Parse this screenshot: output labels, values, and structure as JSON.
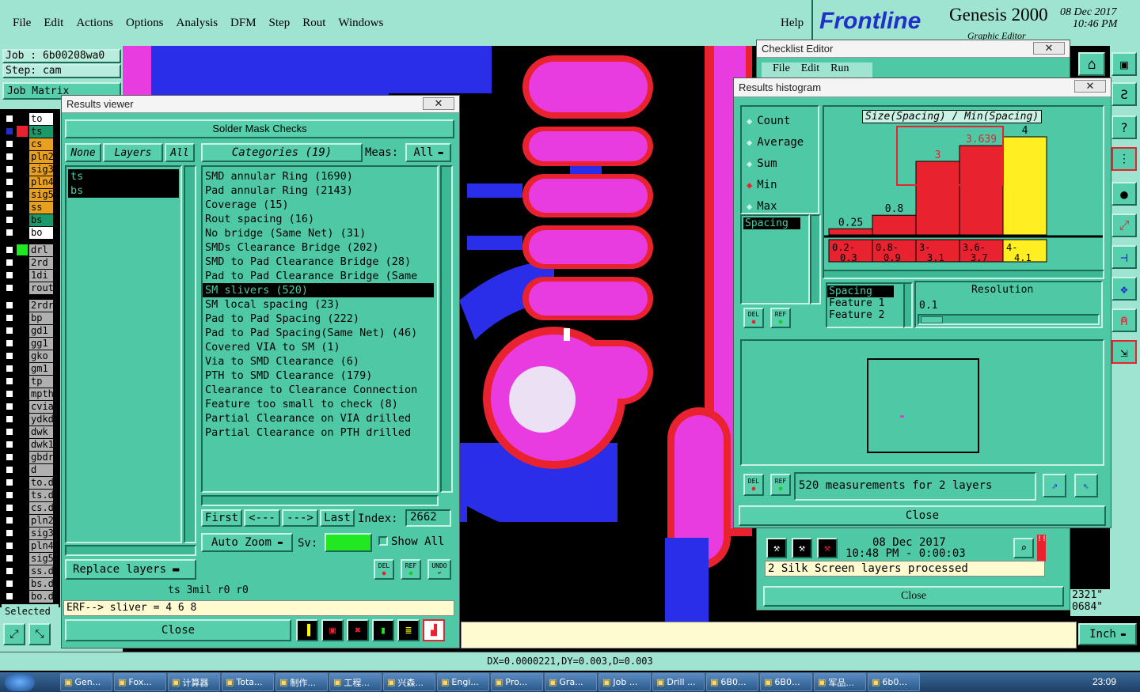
{
  "menu": [
    "File",
    "Edit",
    "Actions",
    "Options",
    "Analysis",
    "DFM",
    "Step",
    "Rout",
    "Windows"
  ],
  "help": "Help",
  "brand": {
    "logo": "Frontline",
    "product": "Genesis 2000",
    "sub": "Graphic Editor",
    "date": "08 Dec 2017",
    "time": "10:46 PM"
  },
  "job": {
    "job": "Job  :  6b00208wa0",
    "step": "Step: cam",
    "matrix": "Job Matrix"
  },
  "layers": [
    {
      "name": "to",
      "color": "#ffffff"
    },
    {
      "name": "ts",
      "color": "#1a9a6a"
    },
    {
      "name": "cs",
      "color": "#e8a020"
    },
    {
      "name": "pln2",
      "color": "#e8a020"
    },
    {
      "name": "sig3",
      "color": "#e8a020"
    },
    {
      "name": "pln4",
      "color": "#e8a020"
    },
    {
      "name": "sig5",
      "color": "#e8a020"
    },
    {
      "name": "ss",
      "color": "#e8a020"
    },
    {
      "name": "bs",
      "color": "#1a9a6a"
    },
    {
      "name": "bo",
      "color": "#ffffff"
    },
    {
      "name": "drl",
      "color": "#b0b0b0"
    },
    {
      "name": "2rd",
      "color": "#b0b0b0"
    },
    {
      "name": "1di",
      "color": "#b0b0b0"
    },
    {
      "name": "rout",
      "color": "#b0b0b0"
    },
    {
      "name": "2rdr",
      "color": "#b0b0b0"
    },
    {
      "name": "bp",
      "color": "#b0b0b0"
    },
    {
      "name": "gd1",
      "color": "#b0b0b0"
    },
    {
      "name": "gg1",
      "color": "#b0b0b0"
    },
    {
      "name": "gko",
      "color": "#b0b0b0"
    },
    {
      "name": "gm1",
      "color": "#b0b0b0"
    },
    {
      "name": "tp",
      "color": "#b0b0b0"
    },
    {
      "name": "mpth",
      "color": "#b0b0b0"
    },
    {
      "name": "cvia",
      "color": "#b0b0b0"
    },
    {
      "name": "ydkd",
      "color": "#b0b0b0"
    },
    {
      "name": "dwk",
      "color": "#b0b0b0"
    },
    {
      "name": "dwk1",
      "color": "#b0b0b0"
    },
    {
      "name": "gbdr",
      "color": "#b0b0b0"
    },
    {
      "name": "d",
      "color": "#b0b0b0"
    },
    {
      "name": "to.d",
      "color": "#b0b0b0"
    },
    {
      "name": "ts.d",
      "color": "#b0b0b0"
    },
    {
      "name": "cs.d",
      "color": "#b0b0b0"
    },
    {
      "name": "pln2",
      "color": "#b0b0b0"
    },
    {
      "name": "sig3",
      "color": "#b0b0b0"
    },
    {
      "name": "pln4",
      "color": "#b0b0b0"
    },
    {
      "name": "sig5",
      "color": "#b0b0b0"
    },
    {
      "name": "ss.d",
      "color": "#b0b0b0"
    },
    {
      "name": "bs.d",
      "color": "#b0b0b0"
    },
    {
      "name": "bo.d",
      "color": "#b0b0b0"
    }
  ],
  "selected": "Selected",
  "results_viewer": {
    "title": "Results viewer",
    "header": "Solder Mask Checks",
    "none": "None",
    "layers": "Layers",
    "all": "All",
    "layer_items": [
      "ts",
      "bs"
    ],
    "categories": "Categories (19)",
    "meas_label": "Meas:",
    "meas_value": "All",
    "items": [
      "SMD annular Ring (1690)",
      "Pad annular Ring (2143)",
      "Coverage (15)",
      "Rout spacing (16)",
      "No bridge (Same Net) (31)",
      "SMDs Clearance Bridge (202)",
      "SMD to Pad Clearance Bridge (28)",
      "Pad to Pad Clearance Bridge (Same",
      "SM slivers (520)",
      "SM local spacing (23)",
      "Pad to Pad Spacing (222)",
      "Pad to Pad Spacing(Same Net) (46)",
      "Covered VIA to SM (1)",
      "Via to SMD Clearance (6)",
      "PTH to SMD Clearance (179)",
      "Clearance to Clearance Connection",
      "Feature too small to check (8)",
      "Partial Clearance on VIA drilled",
      "Partial Clearance on PTH drilled"
    ],
    "first": "First",
    "prev": "<---",
    "next": "--->",
    "last": "Last",
    "index_label": "Index:",
    "index_value": "2662",
    "auto_zoom": "Auto Zoom",
    "sv": "Sv:",
    "show_all": "Show All",
    "replace": "Replace layers",
    "del": "DEL",
    "ref": "REF",
    "undo": "UNDO",
    "status": "ts 3mil   r0   r0",
    "erf": "ERF--> sliver = 4 6 8",
    "close": "Close"
  },
  "checklist": {
    "title": "Checklist Editor",
    "menu": [
      "File",
      "Edit",
      "Run"
    ],
    "date": "08 Dec 2017",
    "time": "10:48 PM - 0:00:03",
    "msg": "2 Silk Screen layers processed",
    "close": "Close"
  },
  "histogram": {
    "title": "Results histogram",
    "modes": [
      "Count",
      "Average",
      "Sum",
      "Min",
      "Max"
    ],
    "selected_mode": "Min",
    "list_item": "Spacing",
    "graph_title": "Size(Spacing) / Min(Spacing)",
    "bins": [
      "0.2-0.3",
      "0.8-0.9",
      "3-3.1",
      "3.6-3.7",
      "4-4.1"
    ],
    "bar_labels": [
      "0.25",
      "0.8",
      "3",
      "3.639",
      "4"
    ],
    "prop_items": [
      "Spacing",
      "Feature 1",
      "Feature 2"
    ],
    "resolution_label": "Resolution",
    "resolution_value": "0.1",
    "measurements": "520 measurements for 2 layers",
    "close": "Close"
  },
  "chart_data": {
    "type": "bar",
    "title": "Size(Spacing) / Min(Spacing)",
    "categories": [
      "0.2-0.3",
      "0.8-0.9",
      "3-3.1",
      "3.6-3.7",
      "4-4.1"
    ],
    "values": [
      0.25,
      0.8,
      3,
      3.639,
      4
    ],
    "ylim": [
      0,
      4
    ]
  },
  "bottom": {
    "coords": "DX=0.0000221,DY=0.003,D=0.003",
    "unit": "Inch",
    "r1": "2321\"",
    "r2": "0684\""
  },
  "taskbar": [
    "Gen...",
    "Fox...",
    "计算器",
    "Tota...",
    "制作...",
    "工程...",
    "兴森...",
    "Engi...",
    "Pro...",
    "Gra...",
    "Job ...",
    "Drill ...",
    "6B0...",
    "6B0...",
    "军品...",
    "6b0..."
  ],
  "clock": "23:09"
}
